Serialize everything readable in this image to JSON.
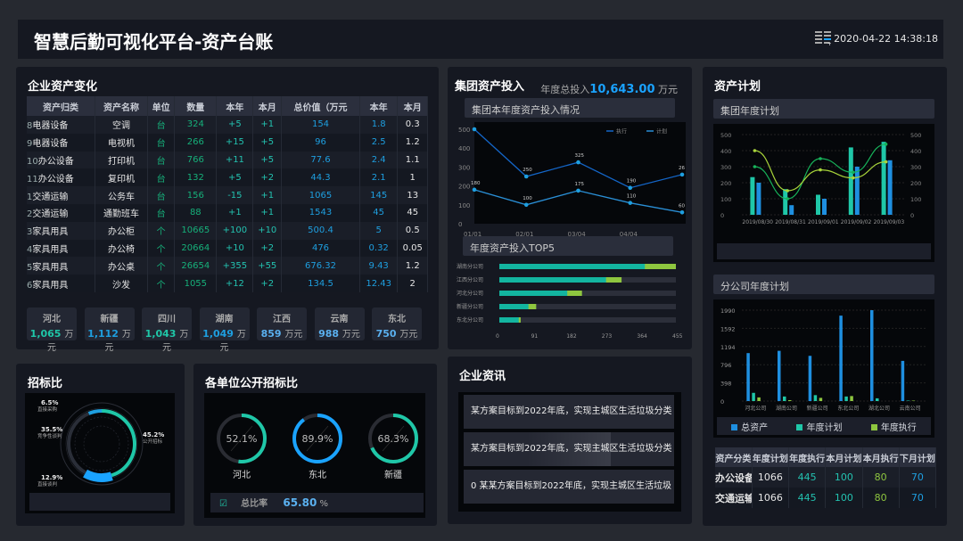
{
  "header": {
    "title": "智慧后勤可视化平台-资产台账",
    "datetime": "2020-04-22 14:38:18",
    "icon": "calendar-icon"
  },
  "assets": {
    "title": "企业资产变化",
    "columns": [
      "资产归类",
      "资产名称",
      "单位",
      "数量",
      "本年",
      "本月",
      "总价值（万元",
      "本年",
      "本月"
    ],
    "rows": [
      [
        "8",
        "电器设备",
        "空调",
        "台",
        "324",
        "+5",
        "+1",
        "154",
        "1.8",
        "0.3"
      ],
      [
        "9",
        "电器设备",
        "电视机",
        "台",
        "266",
        "+15",
        "+5",
        "96",
        "2.5",
        "1.2"
      ],
      [
        "10",
        "办公设备",
        "打印机",
        "台",
        "766",
        "+11",
        "+5",
        "77.6",
        "2.4",
        "1.1"
      ],
      [
        "11",
        "办公设备",
        "复印机",
        "台",
        "132",
        "+5",
        "+2",
        "44.3",
        "2.1",
        "1"
      ],
      [
        "1",
        "交通运输",
        "公务车",
        "台",
        "156",
        "-15",
        "+1",
        "1065",
        "145",
        "13"
      ],
      [
        "2",
        "交通运输",
        "通勤班车",
        "台",
        "88",
        "+1",
        "+1",
        "1543",
        "45",
        "45"
      ],
      [
        "3",
        "家具用具",
        "办公柜",
        "个",
        "10665",
        "+100",
        "+10",
        "500.4",
        "5",
        "0.5"
      ],
      [
        "4",
        "家具用具",
        "办公椅",
        "个",
        "20664",
        "+10",
        "+2",
        "476",
        "0.32",
        "0.05"
      ],
      [
        "5",
        "家具用具",
        "办公桌",
        "个",
        "26654",
        "+355",
        "+55",
        "676.32",
        "9.43",
        "1.2"
      ],
      [
        "6",
        "家具用具",
        "沙发",
        "个",
        "1055",
        "+12",
        "+2",
        "134.5",
        "12.43",
        "2"
      ]
    ],
    "regions": [
      {
        "name": "河北",
        "value": "1,065",
        "unit": "万元",
        "color": "#1fc7a8"
      },
      {
        "name": "新疆",
        "value": "1,112",
        "unit": "万元",
        "color": "#1e9fe0"
      },
      {
        "name": "四川",
        "value": "1,043",
        "unit": "万元",
        "color": "#1fc7a8"
      },
      {
        "name": "湖南",
        "value": "1,049",
        "unit": "万元",
        "color": "#1e9fe0"
      },
      {
        "name": "江西",
        "value": "859",
        "unit": "万元",
        "color": "#5ab0ef"
      },
      {
        "name": "云南",
        "value": "988",
        "unit": "万元",
        "color": "#5ab0ef"
      },
      {
        "name": "东北",
        "value": "750",
        "unit": "万元",
        "color": "#5ab0ef"
      }
    ]
  },
  "invest": {
    "title": "集团资产投入",
    "total_label": "年度总投入",
    "total_value": "10,643.00",
    "total_unit": "万元",
    "line_title": "集团本年度资产投入情况",
    "top5_title": "年度资产投入TOP5"
  },
  "plan": {
    "title": "资产计划",
    "group_title": "集团年度计划",
    "branch_title": "分公司年度计划",
    "table": {
      "columns": [
        "资产分类",
        "年度计划",
        "年度执行",
        "本月计划",
        "本月执行",
        "下月计划"
      ],
      "rows": [
        [
          "办公设备",
          "1066",
          "445",
          "100",
          "80",
          "70"
        ],
        [
          "交通运输",
          "1066",
          "445",
          "100",
          "80",
          "70"
        ]
      ]
    }
  },
  "bid": {
    "title": "招标比",
    "segments": [
      {
        "pct": "6.5%",
        "label": "直接采购",
        "value": 6.5,
        "color": "#1e9fe0"
      },
      {
        "pct": "35.5%",
        "label": "竞争性谈判",
        "value": 35.5,
        "color": "#2a2e38"
      },
      {
        "pct": "12.9%",
        "label": "直接谈判",
        "value": 12.9,
        "color": "#1aa3ff"
      },
      {
        "pct": "45.2%",
        "label": "公开招标",
        "value": 45.2,
        "color": "#1fc7a8"
      }
    ]
  },
  "unitbid": {
    "title": "各单位公开招标比",
    "items": [
      {
        "name": "河北",
        "pct": "52.1%",
        "value": 52.1,
        "color": "#1fc7a8"
      },
      {
        "name": "东北",
        "pct": "89.9%",
        "value": 89.9,
        "color": "#1aa3ff"
      },
      {
        "name": "新疆",
        "pct": "68.3%",
        "value": 68.3,
        "color": "#1fc7a8"
      }
    ],
    "total_label": "总比率",
    "total_value": "65.80",
    "total_unit": "%"
  },
  "news": {
    "title": "企业资讯",
    "items": [
      "某方案目标到2022年底，实现主城区生活垃圾分类",
      "某方案目标到2022年底，实现主城区生活垃圾分类",
      "0 某某方案目标到2022年底，实现主城区生活垃圾"
    ]
  },
  "chart_data": [
    {
      "type": "line",
      "title": "集团本年度资产投入情况",
      "categories": [
        "01/01",
        "02/01",
        "03/04",
        "04/04",
        ""
      ],
      "ylim": [
        0,
        500
      ],
      "yticks": [
        0,
        100,
        200,
        300,
        400,
        500
      ],
      "legend": [
        "执行",
        "计划"
      ],
      "series": [
        {
          "name": "执行",
          "values": [
            500,
            250,
            325,
            190,
            260
          ],
          "labels": [
            "",
            "250",
            "325",
            "190",
            "26"
          ],
          "color": "#1466c8"
        },
        {
          "name": "计划",
          "values": [
            180,
            100,
            175,
            110,
            60
          ],
          "labels": [
            "180",
            "100",
            "175",
            "110",
            "60"
          ],
          "color": "#2a8fd6"
        }
      ]
    },
    {
      "type": "bar",
      "title": "年度资产投入TOP5",
      "categories": [
        "湖南分公司",
        "江西分公司",
        "河北分公司",
        "新疆分公司",
        "东北分公司"
      ],
      "xlim": [
        0,
        455
      ],
      "xticks": [
        0,
        91,
        182,
        273,
        364,
        455
      ],
      "series": [
        {
          "name": "执行",
          "values": [
            375,
            275,
            175,
            75,
            50
          ]
        },
        {
          "name": "总计",
          "values": [
            455,
            315,
            213,
            95,
            55
          ]
        }
      ]
    },
    {
      "type": "bar",
      "title": "集团年度计划",
      "categories": [
        "2019/08/30",
        "2019/08/31",
        "2019/09/01",
        "2019/09/02",
        "2019/09/03"
      ],
      "ylim": [
        0,
        500
      ],
      "yticks": [
        0,
        100,
        200,
        300,
        400,
        500
      ],
      "series": [
        {
          "name": "bar1",
          "values": [
            235,
            160,
            125,
            420,
            455
          ],
          "color": "#1fc7a8"
        },
        {
          "name": "bar2",
          "values": [
            200,
            60,
            100,
            300,
            340
          ],
          "color": "#1e8fe0"
        },
        {
          "name": "line1",
          "values": [
            300,
            100,
            350,
            265,
            440
          ],
          "color": "#17b35a"
        },
        {
          "name": "line2",
          "values": [
            400,
            150,
            280,
            230,
            330
          ],
          "color": "#a8d43a"
        }
      ]
    },
    {
      "type": "bar",
      "title": "分公司年度计划",
      "categories": [
        "河北公司",
        "湖南公司",
        "新疆公司",
        "东北公司",
        "湖北公司",
        "云南公司"
      ],
      "ylim": [
        0,
        1990
      ],
      "yticks": [
        0,
        398,
        796,
        1194,
        1592,
        1990
      ],
      "legend": [
        "总资产",
        "年度计划",
        "年度执行"
      ],
      "series": [
        {
          "name": "总资产",
          "values": [
            1050,
            1100,
            990,
            1870,
            1990,
            880
          ],
          "color": "#1e8fe0"
        },
        {
          "name": "年度计划",
          "values": [
            180,
            100,
            130,
            100,
            60,
            10
          ],
          "color": "#1fc7a8"
        },
        {
          "name": "年度执行",
          "values": [
            80,
            20,
            70,
            110,
            0,
            10
          ],
          "color": "#8ec63f"
        }
      ]
    }
  ]
}
